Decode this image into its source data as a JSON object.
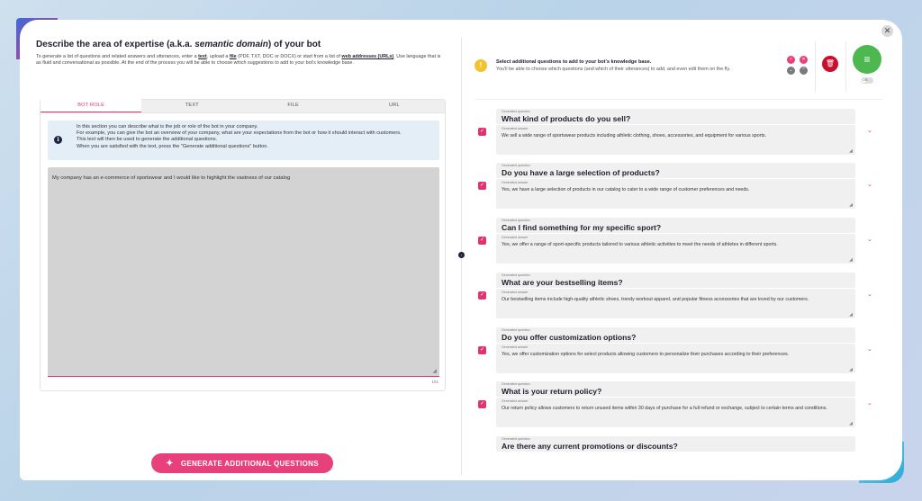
{
  "left": {
    "title_pre": "Describe the area of expertise (a.k.a. ",
    "title_em": "semantic domain",
    "title_post": ") of your bot",
    "intro_1": "To generate a list of questions and related answers and utterances, enter a ",
    "intro_text": "text",
    "intro_2": ", upload a ",
    "intro_file": "file",
    "intro_3": " (PDF, TXT, DOC or DOCX) or start from a list of ",
    "intro_web": "web addresses (URLs)",
    "intro_4": ". Use language that is as fluid and conversational as possible. At the end of the process you will be able to choose which suggestions to add to your bot's knowledge base.",
    "tabs": [
      {
        "label": "BOT ROLE",
        "active": true
      },
      {
        "label": "TEXT",
        "active": false
      },
      {
        "label": "FILE",
        "active": false
      },
      {
        "label": "URL",
        "active": false
      }
    ],
    "info_icon": "i",
    "info_lines": [
      "In this section you can describe what is the job or role of the bot in your company.",
      "For example, you can give the bot an overview of your company, what are your expectations from the bot or how it should interact with customers.",
      "This text will then be used to generate the additional questions.",
      "When you are satisfied with the text, press the \"Generate additional questions\" button."
    ],
    "textarea_value": "My company has an e-commerce of sportswear and I would like to highlight the vastness of our catalog",
    "char_count": "101",
    "generate_button": "GENERATE ADDITIONAL QUESTIONS"
  },
  "right": {
    "warn_title": "Select additional questions to add to your bot's knowledge base.",
    "warn_sub": "You'll be able to choose which questions (and which of their utterances) to add, and even edit them on the fly.",
    "toggle_label": "ON",
    "question_caption": "Generated question",
    "answer_caption": "Generated answer",
    "items": [
      {
        "question": "What kind of products do you sell?",
        "answer": "We sell a wide range of sportswear products including athletic clothing, shoes, accessories, and equipment for various sports."
      },
      {
        "question": "Do you have a large selection of products?",
        "answer": "Yes, we have a large selection of products in our catalog to cater to a wide range of customer preferences and needs."
      },
      {
        "question": "Can I find something for my specific sport?",
        "answer": "Yes, we offer a range of sport-specific products tailored to various athletic activities to meet the needs of athletes in different sports."
      },
      {
        "question": "What are your bestselling items?",
        "answer": "Our bestselling items include high-quality athletic shoes, trendy workout apparel, and popular fitness accessories that are loved by our customers."
      },
      {
        "question": "Do you offer customization options?",
        "answer": "Yes, we offer customization options for select products allowing customers to personalize their purchases according to their preferences."
      },
      {
        "question": "What is your return policy?",
        "answer": "Our return policy allows customers to return unused items within 30 days of purchase for a full refund or exchange, subject to certain terms and conditions."
      },
      {
        "question": "Are there any current promotions or discounts?",
        "answer": ""
      }
    ]
  },
  "colors": {
    "accent": "#e8407a",
    "success": "#4cb84f",
    "danger": "#c8102e",
    "warning": "#f2c230"
  }
}
